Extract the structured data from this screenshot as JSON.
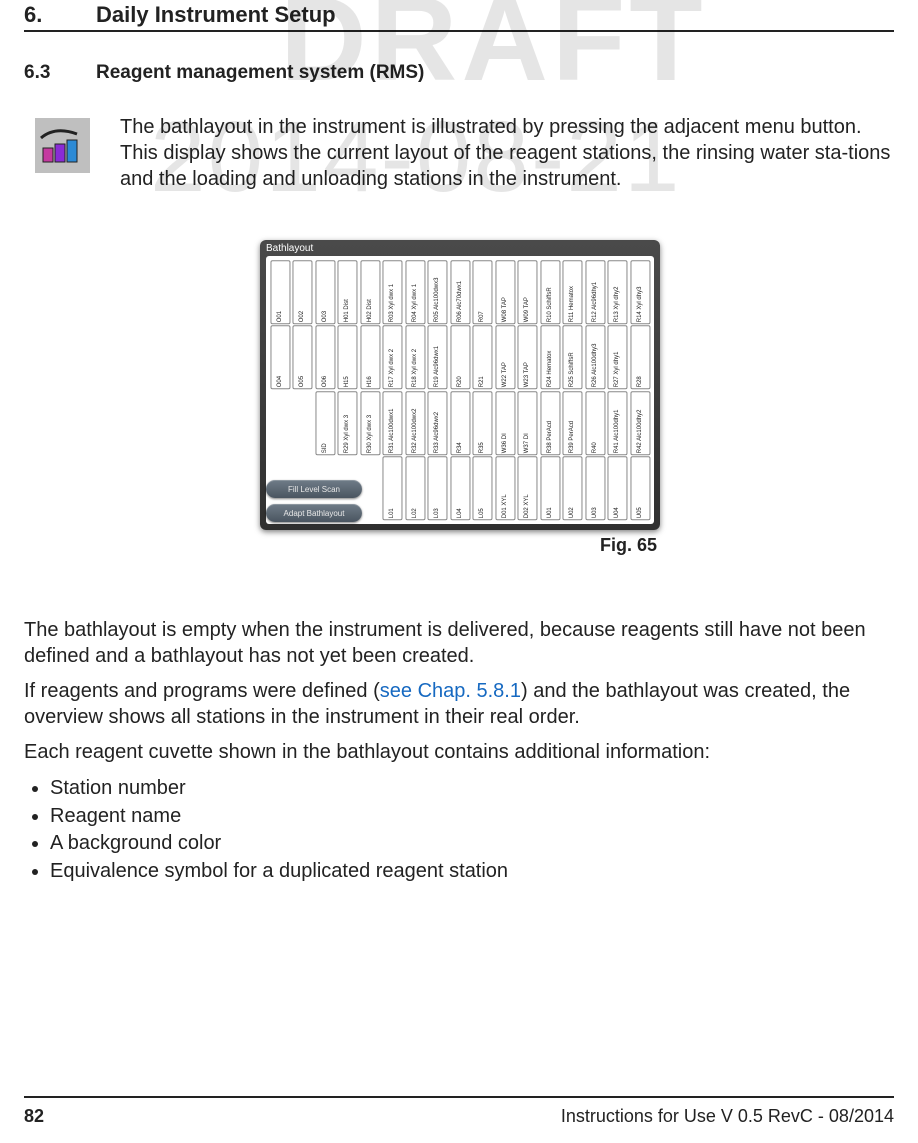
{
  "watermark": {
    "draft": "DRAFT",
    "date": "2014-08-21"
  },
  "section": {
    "num": "6.",
    "title": "Daily Instrument Setup"
  },
  "subsection": {
    "num": "6.3",
    "title": "Reagent management system (RMS)"
  },
  "intro": "The bathlayout in the instrument is illustrated by pressing the adjacent menu button. This display shows the current layout of the reagent stations, the rinsing water sta-tions and the loading and unloading stations in the instrument.",
  "panel": {
    "title": "Bathlayout",
    "buttons": {
      "scan": "Fill Level Scan",
      "adapt": "Adapt Bathlayout"
    },
    "grid": {
      "row1": [
        "O01",
        "O02",
        "O03",
        "H01",
        "H02",
        "R03",
        "R04",
        "R05",
        "R06",
        "R07",
        "W08",
        "W09",
        "R10",
        "R11",
        "R12",
        "R13",
        "R14"
      ],
      "row1b": [
        "",
        "",
        "",
        "Dist",
        "Dist",
        "Xyl dwx 1",
        "Xyl dwx 1",
        "Alc100dwx3",
        "Alc70dwx1",
        "",
        "TAP",
        "TAP",
        "SchiffsR",
        "Hematox",
        "Alc96dhy1",
        "Xyl dhy2",
        "Xyl dhy3"
      ],
      "row2": [
        "O04",
        "O05",
        "O06",
        "H15",
        "H16",
        "R17",
        "R18",
        "R19",
        "R20",
        "R21",
        "W22",
        "W23",
        "R24",
        "R25",
        "R26",
        "R27",
        "R28"
      ],
      "row2b": [
        "",
        "",
        "",
        "",
        "",
        "Xyl dwx 2",
        "Xyl dwx 2",
        "Alc96dwx1",
        "",
        "",
        "TAP",
        "TAP",
        "Hematox",
        "SchiffsR",
        "Alc100dhy3",
        "Xyl dhy1",
        ""
      ],
      "row3": [
        "",
        "",
        "SID",
        "R29",
        "R30",
        "R31",
        "R32",
        "R33",
        "R34",
        "R35",
        "W36",
        "W37",
        "R38",
        "R39",
        "R40",
        "R41",
        "R42"
      ],
      "row3b": [
        "",
        "",
        "",
        "Xyl dwx 3",
        "Xyl dwx 3",
        "Alc100dwx1",
        "Alc100dwx2",
        "Alc96dwx2",
        "",
        "",
        "DI",
        "DI",
        "PerAcd",
        "PerAcd",
        "",
        "Alc100dhy1",
        "Alc100dhy2"
      ],
      "row4": [
        "",
        "",
        "",
        "",
        "",
        "L01",
        "L02",
        "L03",
        "L04",
        "L05",
        "D01",
        "D02",
        "U01",
        "U02",
        "U03",
        "U04",
        "U05"
      ],
      "row4b": [
        "",
        "",
        "",
        "",
        "",
        "",
        "",
        "",
        "",
        "",
        "XYL",
        "XYL",
        "",
        "",
        "",
        "",
        ""
      ]
    }
  },
  "fig": "Fig. 65",
  "para1": "The bathlayout is empty when the instrument is delivered, because reagents still have not been defined and a bathlayout has not yet been created.",
  "para2a": "If reagents and programs were defined (",
  "para2link": "see Chap. 5.8.1",
  "para2b": ") and the bathlayout was created, the overview shows all stations in the instrument in their real order.",
  "para3": "Each reagent cuvette shown in the bathlayout contains additional information:",
  "bullets": [
    "Station number",
    "Reagent name",
    "A background color",
    "Equivalence symbol for a duplicated reagent station"
  ],
  "footer": {
    "page": "82",
    "text": "Instructions for Use V 0.5 RevC - 08/2014"
  }
}
